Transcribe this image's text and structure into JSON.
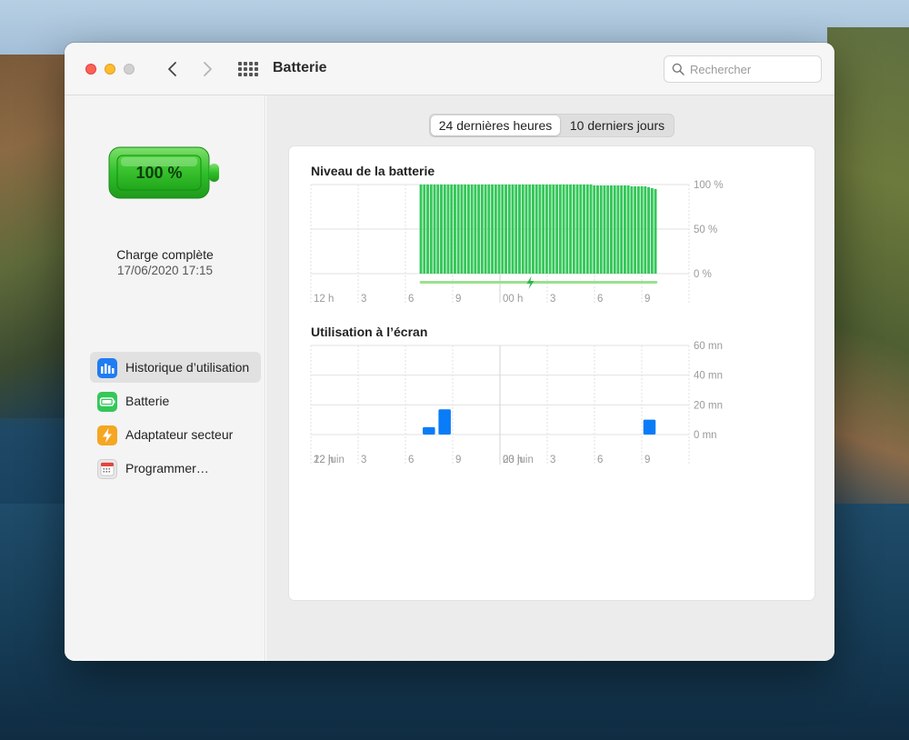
{
  "window": {
    "title": "Batterie",
    "search_placeholder": "Rechercher"
  },
  "sidebar": {
    "battery_percent": "100 %",
    "charge_status": "Charge complète",
    "charge_date": "17/06/2020 17:15",
    "items": [
      {
        "label": "Historique d’utilisation",
        "icon": "bar-chart-icon",
        "color": "#1f7cf2",
        "selected": true
      },
      {
        "label": "Batterie",
        "icon": "battery-icon",
        "color": "#34c759",
        "selected": false
      },
      {
        "label": "Adaptateur secteur",
        "icon": "lightning-icon",
        "color": "#f5a623",
        "selected": false
      },
      {
        "label": "Programmer…",
        "icon": "calendar-icon",
        "color": "#e8e8e8",
        "selected": false
      }
    ]
  },
  "tabs": [
    {
      "label": "24 dernières heures",
      "active": true
    },
    {
      "label": "10 derniers jours",
      "active": false
    }
  ],
  "colors": {
    "battery_green": "#34c759",
    "screen_blue": "#0a7cf7",
    "grid": "#e2e2e2"
  },
  "chart_data": [
    {
      "type": "bar",
      "title": "Niveau de la batterie",
      "y_tick_labels": [
        "100 %",
        "50 %",
        "0 %"
      ],
      "ylim": [
        0,
        100
      ],
      "x_tick_labels": [
        "12 h",
        "3",
        "6",
        "9",
        "00 h",
        "3",
        "6",
        "9"
      ],
      "x_range_hours": [
        12,
        36
      ],
      "bars_start_hour": 18.9,
      "bars_end_hour": 34.0,
      "bar_count": 70,
      "values": [
        100,
        100,
        100,
        100,
        100,
        100,
        100,
        100,
        100,
        100,
        100,
        100,
        100,
        100,
        100,
        100,
        100,
        100,
        100,
        100,
        100,
        100,
        100,
        100,
        100,
        100,
        100,
        100,
        100,
        100,
        100,
        100,
        100,
        100,
        100,
        100,
        100,
        100,
        100,
        100,
        100,
        100,
        100,
        100,
        100,
        100,
        100,
        100,
        100,
        100,
        100,
        99,
        99,
        99,
        99,
        99,
        99,
        99,
        99,
        99,
        99,
        99,
        98,
        98,
        98,
        98,
        98,
        97,
        96,
        95
      ],
      "charging_indicator": "lightning-icon",
      "charging_segment_hours": [
        18.9,
        34.0
      ]
    },
    {
      "type": "bar",
      "title": "Utilisation à l’écran",
      "y_tick_labels": [
        "60 mn",
        "40 mn",
        "20 mn",
        "0 mn"
      ],
      "ylim": [
        0,
        60
      ],
      "x_tick_labels": [
        "12 h",
        "3",
        "6",
        "9",
        "00 h",
        "3",
        "6",
        "9"
      ],
      "x_date_labels": [
        "22 juin",
        "23 juin"
      ],
      "x_range_hours": [
        12,
        36
      ],
      "bars": [
        {
          "hour": 19.0,
          "minutes": 5
        },
        {
          "hour": 20.0,
          "minutes": 17
        },
        {
          "hour": 33.0,
          "minutes": 10
        }
      ]
    }
  ]
}
